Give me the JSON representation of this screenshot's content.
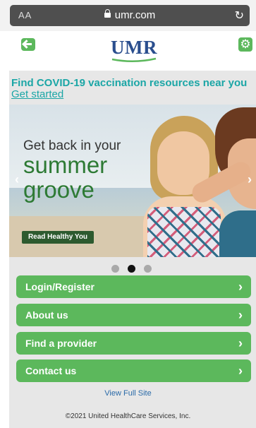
{
  "browser": {
    "text_size_label": "AA",
    "url": "umr.com"
  },
  "header": {
    "logo_text": "UMR"
  },
  "announcement": {
    "text": "Find COVID-19 vaccination resources near you",
    "link": "Get started"
  },
  "banner": {
    "line1": "Get back in your",
    "line2": "summer",
    "line3": "groove",
    "button": "Read Healthy You"
  },
  "carousel": {
    "total": 3,
    "active_index": 1
  },
  "menu": [
    {
      "label": "Login/Register"
    },
    {
      "label": "About us"
    },
    {
      "label": "Find a provider"
    },
    {
      "label": "Contact us"
    }
  ],
  "footer": {
    "full_site": "View Full Site",
    "copyright": "©2021 United HealthCare Services, Inc."
  },
  "colors": {
    "accent_green": "#5cb85c",
    "teal_text": "#1ba6a6",
    "logo_blue": "#2a4e8e",
    "panel_grey": "#e7e7e7"
  },
  "icons": [
    "lock-icon",
    "reload-icon",
    "back-arrow-icon",
    "gear-icon",
    "chevron-right-icon",
    "chevron-left-icon"
  ]
}
